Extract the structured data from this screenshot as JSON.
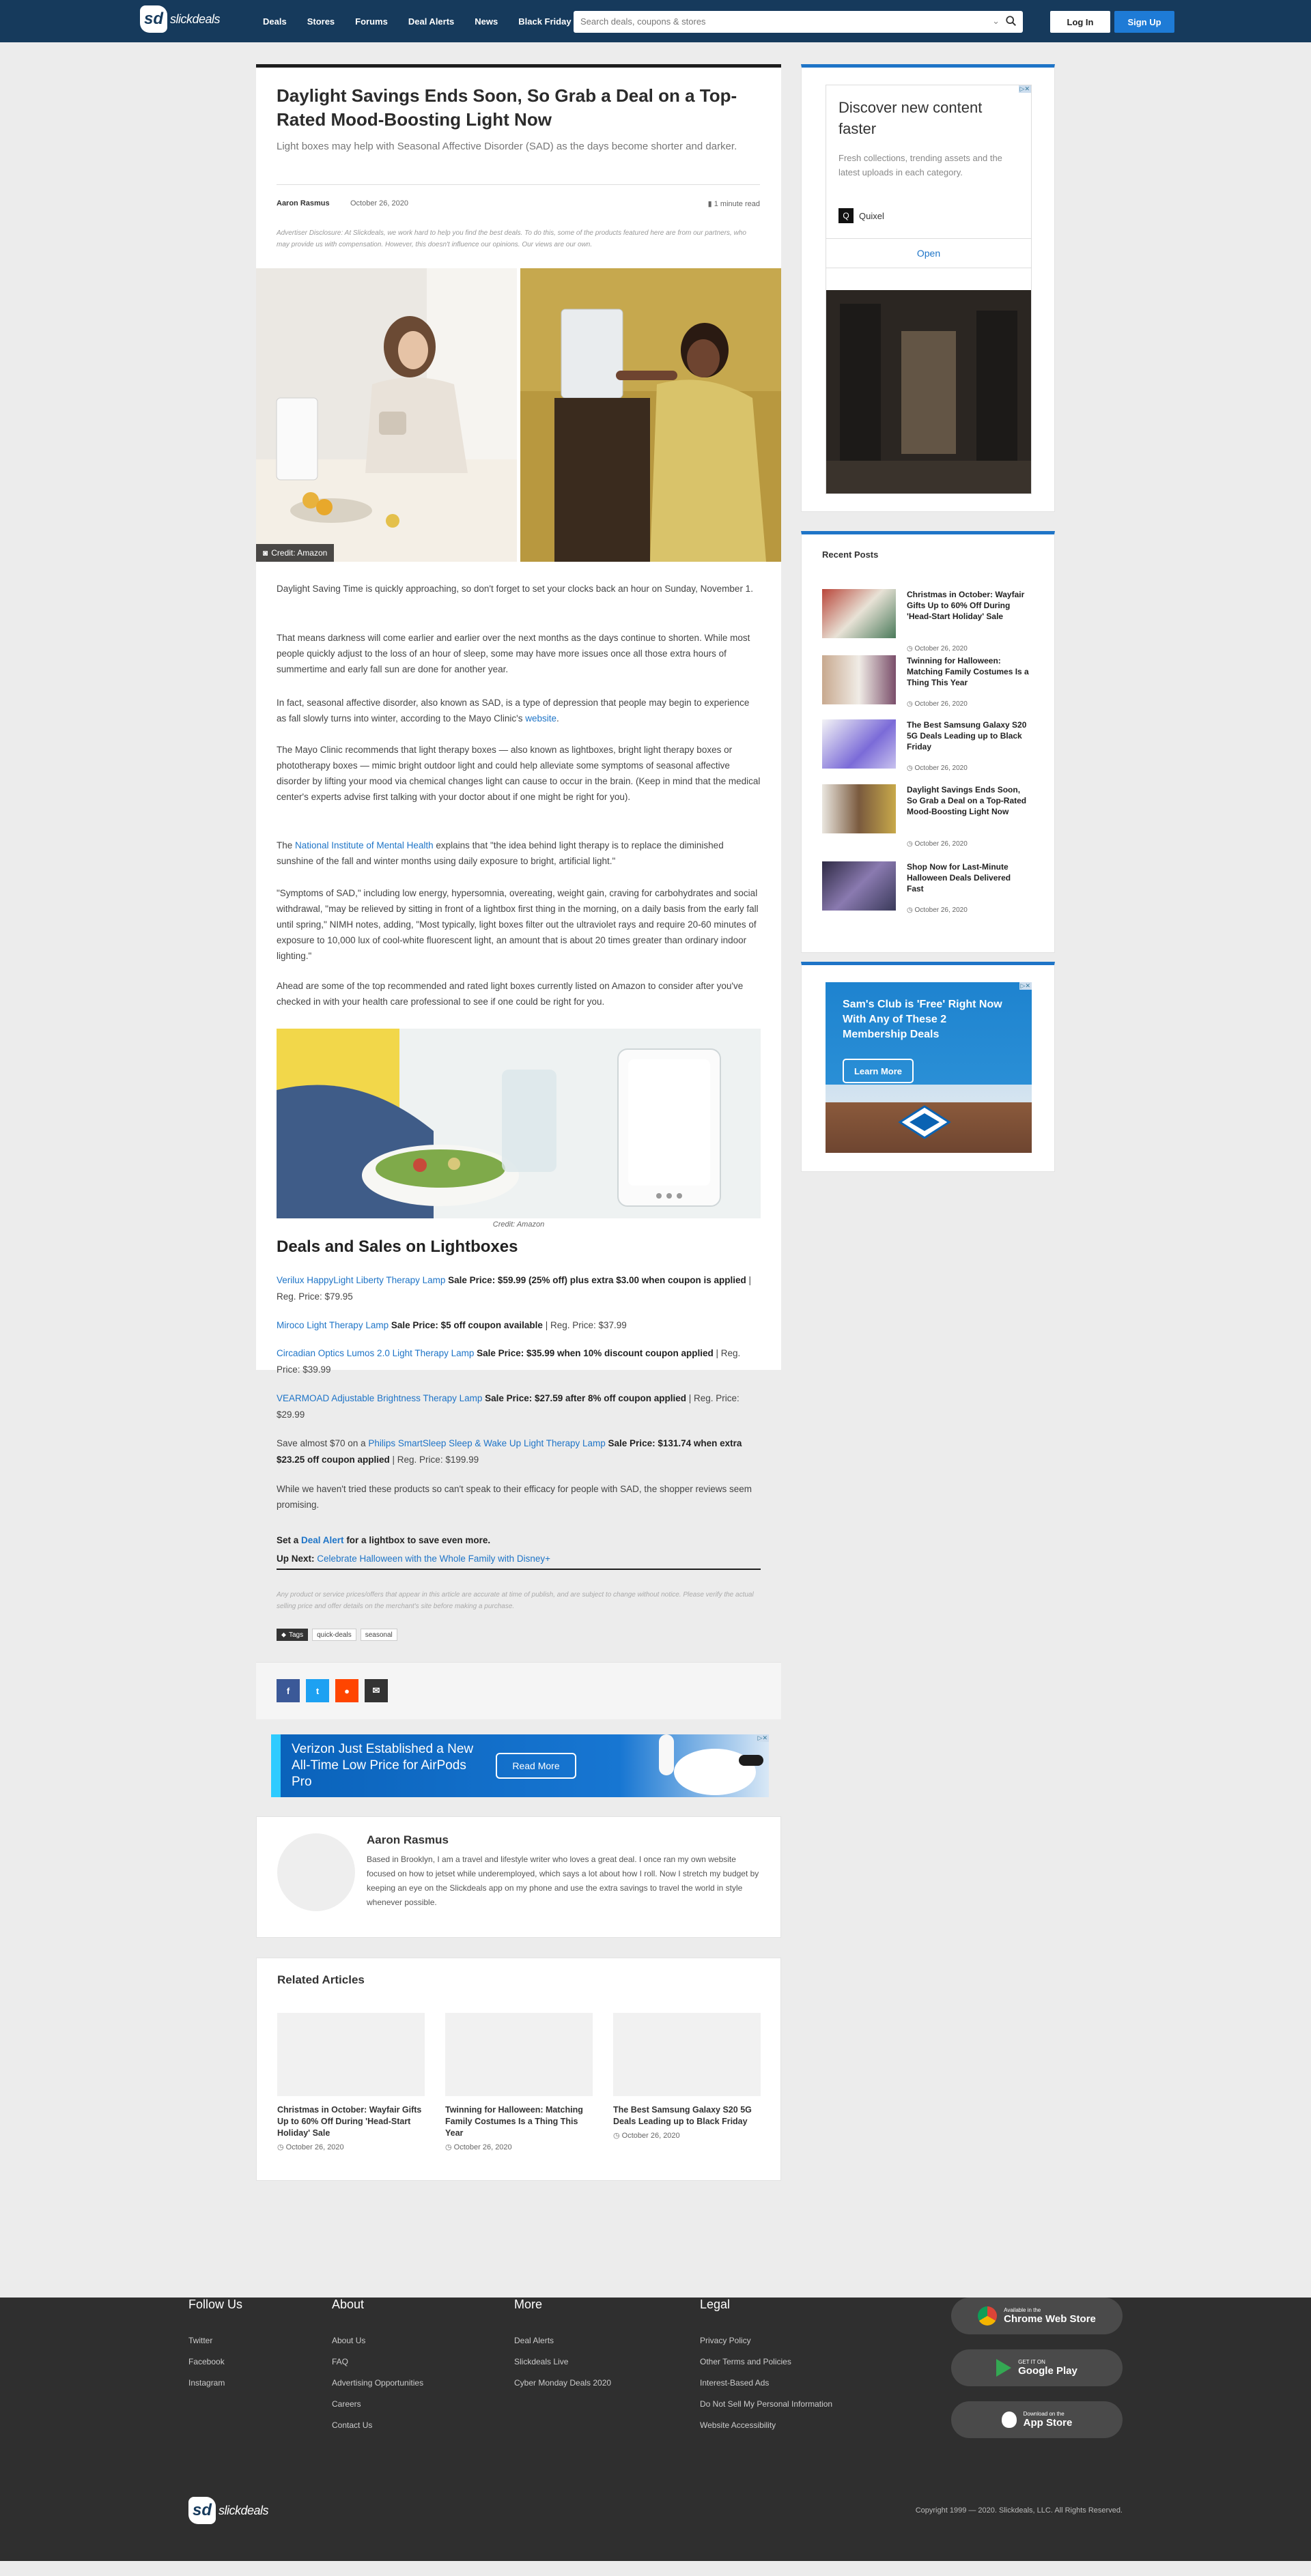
{
  "header": {
    "logo_text": "slickdeals",
    "nav": [
      "Deals",
      "Stores",
      "Forums",
      "Deal Alerts",
      "News",
      "Black Friday"
    ],
    "search_placeholder": "Search deals, coupons & stores",
    "login": "Log In",
    "signup": "Sign Up"
  },
  "article": {
    "title": "Daylight Savings Ends Soon, So Grab a Deal on a Top-Rated Mood-Boosting Light Now",
    "subtitle": "Light boxes may help with Seasonal Affective Disorder (SAD) as the days become shorter and darker.",
    "author": "Aaron Rasmus",
    "date": "October 26, 2020",
    "read_time": "1 minute read",
    "disclosure": "Advertiser Disclosure: At Slickdeals, we work hard to help you find the best deals. To do this, some of the products featured here are from our partners, who may provide us with compensation. However, this doesn't influence our opinions. Our views are our own.",
    "hero_credit": "Credit: Amazon",
    "p1": "Daylight Saving Time is quickly approaching, so don't forget to set your clocks back an hour on Sunday, November 1.",
    "p2": "That means darkness will come earlier and earlier over the next months as the days continue to shorten. While most people quickly adjust to the loss of an hour of sleep, some may have more issues once all those extra hours of summertime and early fall sun are done for another year.",
    "p3_a": "In fact, seasonal affective disorder, also known as SAD, is a type of depression that people may begin to experience as fall slowly turns into winter, according to the Mayo Clinic's ",
    "p3_link": "website",
    "p3_b": ".",
    "p4": "The Mayo Clinic recommends that light therapy boxes — also known as lightboxes, bright light therapy boxes or phototherapy boxes — mimic bright outdoor light and could help alleviate some symptoms of seasonal affective disorder by lifting your mood via chemical changes light can cause to occur in the brain. (Keep in mind that the medical center's experts advise first talking with your doctor about if one might be right for you).",
    "p5_a": "The ",
    "p5_link": "National Institute of Mental Health",
    "p5_b": " explains that \"the idea behind light therapy is to replace the diminished sunshine of the fall and winter months using daily exposure to bright, artificial light.\"",
    "p6": "\"Symptoms of SAD,\" including low energy, hypersomnia, overeating, weight gain, craving for carbohydrates and social withdrawal, \"may be relieved by sitting in front of a lightbox first thing in the morning, on a daily basis from the early fall until spring,\" NIMH notes, adding, \"Most typically, light boxes filter out the ultraviolet rays and require 20-60 minutes of exposure to 10,000 lux of cool-white fluorescent light, an amount that is about 20 times greater than ordinary indoor lighting.\"",
    "p7": "Ahead are some of the top recommended and rated light boxes currently listed on Amazon to consider after you've checked in with your health care professional to see if one could be right for you.",
    "img2_caption": "Credit: Amazon",
    "deals_title": "Deals and Sales on Lightboxes",
    "deals": [
      {
        "pre": "",
        "link": "Verilux HappyLight Liberty Therapy Lamp",
        "sale": " Sale Price: $59.99 (25% off)  plus extra $3.00 when coupon is applied",
        "reg": " | Reg. Price: $79.95"
      },
      {
        "pre": "",
        "link": "Miroco Light Therapy Lamp",
        "sale": " Sale Price: $5 off coupon available",
        "reg": " | Reg. Price: $37.99"
      },
      {
        "pre": "",
        "link": "Circadian Optics Lumos 2.0 Light Therapy Lamp",
        "sale": " Sale Price: $35.99 when 10% discount coupon applied",
        "reg": " | Reg. Price: $39.99"
      },
      {
        "pre": "",
        "link": "VEARMOAD Adjustable Brightness Therapy Lamp",
        "sale": " Sale Price: $27.59 after 8% off coupon applied",
        "reg": " | Reg. Price: $29.99"
      },
      {
        "pre": "Save almost $70 on a ",
        "link": "Philips SmartSleep Sleep & Wake Up Light Therapy Lamp",
        "sale": "  Sale Price: $131.74 when extra $23.25 off coupon applied",
        "reg": " | Reg. Price: $199.99"
      }
    ],
    "p8": "While we haven't tried these products so can't speak to their efficacy for people with SAD, the shopper reviews seem promising.",
    "alert_a": "Set a ",
    "alert_link": "Deal Alert",
    "alert_b": " for a lightbox to save even more.",
    "upnext_label": "Up Next: ",
    "upnext_link": "Celebrate Halloween with the Whole Family with Disney+",
    "fine_print": "Any product or service prices/offers that appear in this article are accurate at time of publish, and are subject to change without notice. Please verify the actual selling price and offer details on the merchant's site before making a purchase.",
    "tags_label": "Tags",
    "tags": [
      "quick-deals",
      "seasonal"
    ]
  },
  "ad_banner": {
    "text": "Verizon Just Established a New All-Time Low Price for AirPods Pro",
    "button": "Read More"
  },
  "author_box": {
    "name": "Aaron Rasmus",
    "bio": "Based in Brooklyn, I am a travel and lifestyle writer who loves a great deal. I once ran my own website focused on how to jetset while underemployed, which says a lot about how I roll. Now I stretch my budget by keeping an eye on the Slickdeals app on my phone and use the extra savings to travel the world in style whenever possible."
  },
  "related": {
    "title": "Related Articles",
    "items": [
      {
        "title": "Christmas in October: Wayfair Gifts Up to 60% Off During 'Head-Start Holiday' Sale",
        "date": "October 26, 2020"
      },
      {
        "title": "Twinning for Halloween: Matching Family Costumes Is a Thing This Year",
        "date": "October 26, 2020"
      },
      {
        "title": "The Best Samsung Galaxy S20 5G Deals Leading up to Black Friday",
        "date": "October 26, 2020"
      }
    ]
  },
  "sidebar": {
    "ad1": {
      "title": "Discover new content faster",
      "desc": "Fresh collections, trending assets and the latest uploads in each category.",
      "brand": "Quixel",
      "open": "Open"
    },
    "recent_title": "Recent Posts",
    "recent": [
      {
        "title": "Christmas in October: Wayfair Gifts Up to 60% Off During 'Head-Start Holiday' Sale",
        "date": "October 26, 2020"
      },
      {
        "title": "Twinning for Halloween: Matching Family Costumes Is a Thing This Year",
        "date": "October 26, 2020"
      },
      {
        "title": "The Best Samsung Galaxy S20 5G Deals Leading up to Black Friday",
        "date": "October 26, 2020"
      },
      {
        "title": "Daylight Savings Ends Soon, So Grab a Deal on a Top-Rated Mood-Boosting Light Now",
        "date": "October 26, 2020"
      },
      {
        "title": "Shop Now for Last-Minute Halloween Deals Delivered Fast",
        "date": "October 26, 2020"
      }
    ],
    "ad2": {
      "text": "Sam's Club is 'Free' Right Now With Any of These 2 Membership Deals",
      "button": "Learn More"
    }
  },
  "footer": {
    "cols": [
      {
        "title": "Follow Us",
        "links": [
          "Twitter",
          "Facebook",
          "Instagram"
        ]
      },
      {
        "title": "About",
        "links": [
          "About Us",
          "FAQ",
          "Advertising Opportunities",
          "Careers",
          "Contact Us"
        ]
      },
      {
        "title": "More",
        "links": [
          "Deal Alerts",
          "Slickdeals Live",
          "Cyber Monday Deals 2020"
        ]
      },
      {
        "title": "Legal",
        "links": [
          "Privacy Policy",
          "Other Terms and Policies",
          "Interest-Based Ads",
          "Do Not Sell My Personal Information",
          "Website Accessibility"
        ]
      }
    ],
    "stores": [
      {
        "small": "Available in the",
        "big": "Chrome Web Store"
      },
      {
        "small": "GET IT ON",
        "big": "Google Play"
      },
      {
        "small": "Download on the",
        "big": "App Store"
      }
    ],
    "copyright": "Copyright 1999 — 2020. Slickdeals, LLC. All Rights Reserved.",
    "logo_text": "slickdeals"
  }
}
